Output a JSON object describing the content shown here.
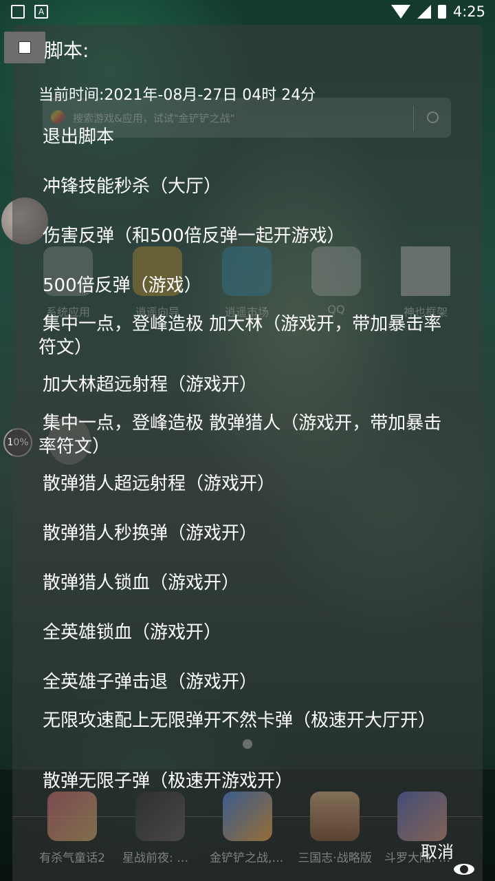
{
  "status_bar": {
    "time": "4:25",
    "notif_icon_2": "A"
  },
  "launcher": {
    "search_placeholder": "搜索游戏&应用，试试\"金铲铲之战\"",
    "apps": [
      {
        "label": "系统应用"
      },
      {
        "label": "逍遥向导"
      },
      {
        "label": "逍遥市场"
      },
      {
        "label": "QQ"
      },
      {
        "label": "神也框架"
      }
    ],
    "dock": [
      {
        "label": "有杀气童话2"
      },
      {
        "label": "星战前夜: 无烬..."
      },
      {
        "label": "金铲铲之战, ..."
      },
      {
        "label": "三国志·战略版"
      },
      {
        "label": "斗罗大陆: 魂..."
      }
    ],
    "float_percent": "10%"
  },
  "dialog": {
    "title": "脚本:",
    "current_time": "当前时间:2021年-08月-27日 04时 24分",
    "items": [
      "退出脚本",
      "冲锋技能秒杀（大厅）",
      "伤害反弹（和500倍反弹一起开游戏）",
      "500倍反弹（游戏）",
      "集中一点，登峰造极 加大林（游戏开，带加暴击率符文）",
      "加大林超远射程（游戏开）",
      "集中一点，登峰造极 散弹猎人（游戏开，带加暴击率符文）",
      "散弹猎人超远射程（游戏开）",
      "散弹猎人秒换弹（游戏开）",
      "散弹猎人锁血（游戏开）",
      "全英雄锁血（游戏开）",
      "全英雄子弹击退（游戏开）",
      "无限攻速配上无限弹开不然卡弹（极速开大厅开）",
      "散弹无限子弹（极速开游戏开）"
    ],
    "cancel_label": "取消"
  }
}
